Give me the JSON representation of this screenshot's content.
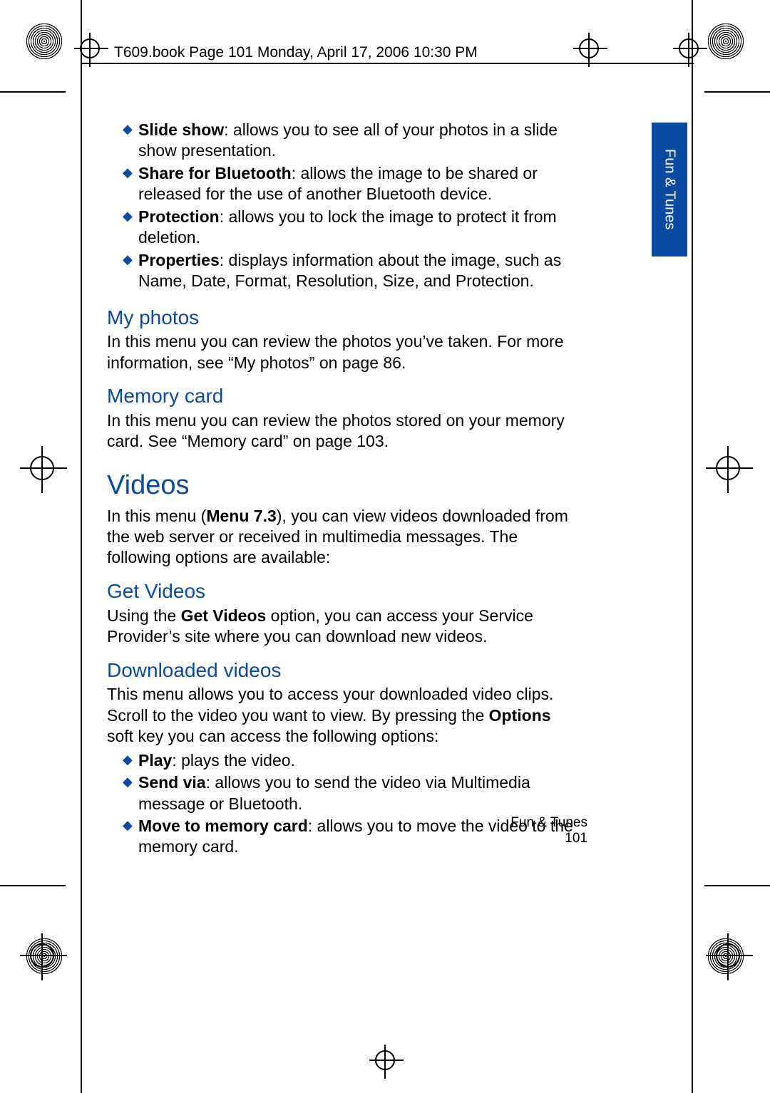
{
  "header_line": "T609.book  Page 101  Monday, April 17, 2006  10:30 PM",
  "section_tab": "Fun & Tunes",
  "intro_bullets": [
    {
      "term": "Slide show",
      "text": ": allows you to see all of your photos in a slide show presentation."
    },
    {
      "term": "Share for Bluetooth",
      "text": ": allows the image to be shared or released for the use of another Bluetooth device."
    },
    {
      "term": "Protection",
      "text": ": allows you to lock the image to protect it from deletion."
    },
    {
      "term": "Properties",
      "text": ": displays information about the image, such as Name, Date, Format, Resolution, Size, and Protection."
    }
  ],
  "my_photos": {
    "heading": "My photos",
    "body": "In this menu you can review the photos you’ve taken. For more information, see “My photos” on page 86."
  },
  "memory_card": {
    "heading": "Memory card",
    "body": "In this menu you can review the photos stored on your memory card. See “Memory card” on page 103."
  },
  "videos": {
    "heading": "Videos",
    "intro_pre": "In this menu (",
    "intro_bold": "Menu 7.3",
    "intro_post": "), you can view videos downloaded from the web server or received in multimedia messages. The following options are available:"
  },
  "get_videos": {
    "heading": "Get Videos",
    "body_pre": "Using the ",
    "body_bold": "Get Videos",
    "body_post": " option, you can access your Service Provider’s site where you can download new videos."
  },
  "downloaded": {
    "heading": "Downloaded videos",
    "body_pre": "This menu allows you to access your downloaded video clips. Scroll to the video you want to view. By pressing the ",
    "body_bold": "Options",
    "body_post": " soft key you can access the following options:",
    "bullets": [
      {
        "term": "Play",
        "text": ": plays the video."
      },
      {
        "term": "Send via",
        "text": ": allows you to send the video via Multimedia message or Bluetooth."
      },
      {
        "term": "Move to memory card",
        "text": ": allows you to move the video to the memory card."
      }
    ]
  },
  "footer": {
    "section": "Fun & Tunes",
    "page": "101"
  }
}
